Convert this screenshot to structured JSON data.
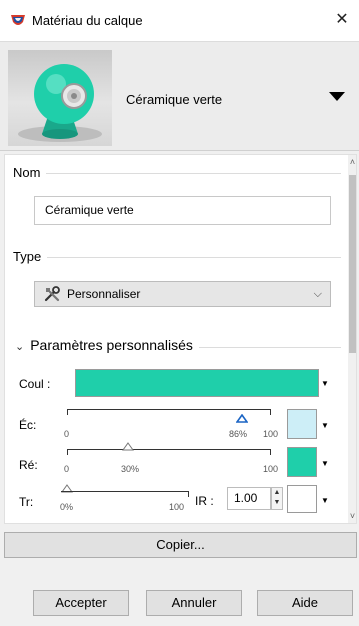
{
  "window": {
    "title": "Matériau du calque"
  },
  "preview": {
    "material_name": "Céramique verte"
  },
  "name_section": {
    "label": "Nom",
    "value": "Céramique verte"
  },
  "type_section": {
    "label": "Type",
    "selected": "Personnaliser"
  },
  "custom_params": {
    "label": "Paramètres personnalisés",
    "color": {
      "label": "Coul :",
      "value_hex": "#1fcfaa"
    },
    "reflection": {
      "label": "Éc:",
      "min": "0",
      "max": "100",
      "value_text": "86%",
      "value": 0.86,
      "swatch_hex": "#cdeef7"
    },
    "refraction": {
      "label": "Ré:",
      "min": "0",
      "max": "100",
      "value_text": "30%",
      "value": 0.3,
      "swatch_hex": "#1fcfaa"
    },
    "transparency": {
      "label": "Tr:",
      "min": "0%",
      "max": "100",
      "value": 0.0,
      "ir_label": "IR :",
      "ir_value": "1.00",
      "swatch_hex": "#ffffff"
    }
  },
  "buttons": {
    "copy": "Copier...",
    "accept": "Accepter",
    "cancel": "Annuler",
    "help": "Aide"
  },
  "icons": {
    "app": "material-app-icon",
    "type": "tools-icon"
  },
  "colors": {
    "accent": "#1fcfaa",
    "thumb_blue": "#2b78c8"
  }
}
